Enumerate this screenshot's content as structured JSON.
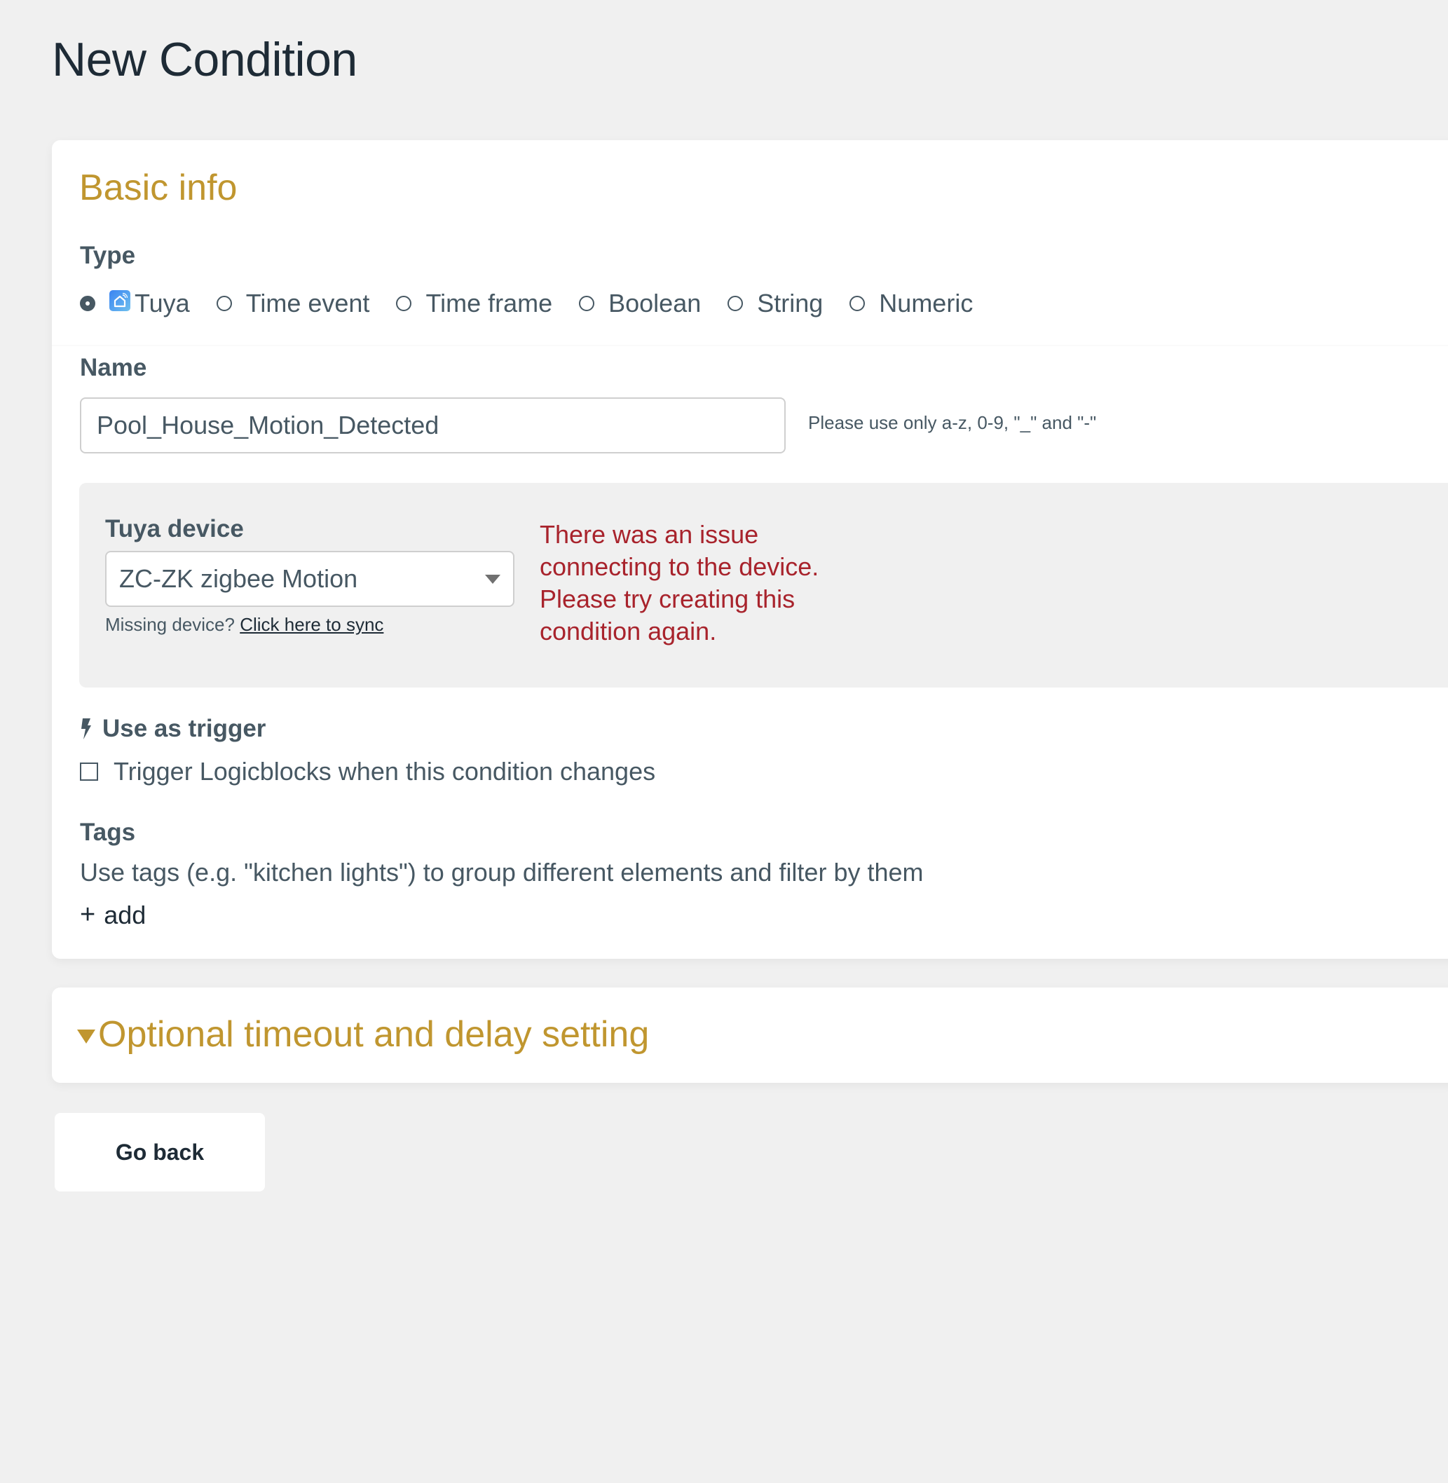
{
  "page": {
    "title": "New Condition"
  },
  "basic_info": {
    "section_title": "Basic info",
    "type": {
      "label": "Type",
      "options": [
        {
          "label": "Tuya",
          "selected": true,
          "icon": "tuya-smart-home-icon"
        },
        {
          "label": "Time event",
          "selected": false
        },
        {
          "label": "Time frame",
          "selected": false
        },
        {
          "label": "Boolean",
          "selected": false
        },
        {
          "label": "String",
          "selected": false
        },
        {
          "label": "Numeric",
          "selected": false
        }
      ]
    },
    "name": {
      "label": "Name",
      "value": "Pool_House_Motion_Detected",
      "hint": "Please use only a-z, 0-9, \"_\" and \"-\""
    },
    "device": {
      "label": "Tuya device",
      "selected": "ZC-ZK zigbee Motion",
      "missing_text": "Missing device?",
      "sync_link": "Click here to sync",
      "error": "There was an issue connecting to the device. Please try creating this condition again."
    },
    "trigger": {
      "label": "Use as trigger",
      "icon": "lightning-bolt-icon",
      "checkbox_label": "Trigger Logicblocks when this condition changes",
      "checked": false
    },
    "tags": {
      "label": "Tags",
      "description": "Use tags (e.g. \"kitchen lights\") to group different elements and filter by them",
      "add_label": "add",
      "add_icon": "+"
    }
  },
  "optional": {
    "section_title": "Optional timeout and delay setting",
    "expanded": false
  },
  "actions": {
    "go_back_label": "Go back"
  },
  "colors": {
    "accent": "#c0962f",
    "error": "#a8232c",
    "text": "#475863",
    "background": "#f0f0f0"
  }
}
